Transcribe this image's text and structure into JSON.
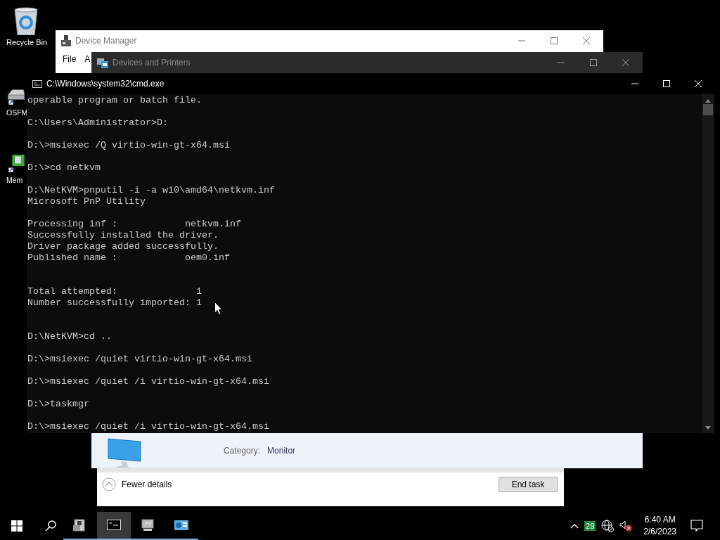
{
  "desktop_icons": [
    {
      "label": "Recycle Bin",
      "kind": "recycle"
    },
    {
      "label": "OSFM",
      "kind": "drive"
    },
    {
      "label": "Mem",
      "kind": "board"
    }
  ],
  "device_manager": {
    "title": "Device Manager",
    "menu": [
      "File",
      "A"
    ]
  },
  "devices_and_printers": {
    "title": "Devices and Printers",
    "device": {
      "category_label": "Category:",
      "category": "Monitor"
    }
  },
  "task_manager": {
    "toggle": "Fewer details",
    "button": "End task"
  },
  "console": {
    "title": "C:\\Windows\\system32\\cmd.exe",
    "lines": [
      {
        "kind": "text",
        "text": "operable program or batch file."
      },
      {
        "kind": "blank"
      },
      {
        "kind": "text",
        "text": "C:\\Users\\Administrator>D:"
      },
      {
        "kind": "blank"
      },
      {
        "kind": "text",
        "text": "D:\\>msiexec /Q virtio-win-gt-x64.msi"
      },
      {
        "kind": "blank"
      },
      {
        "kind": "text",
        "text": "D:\\>cd netkvm"
      },
      {
        "kind": "blank"
      },
      {
        "kind": "text",
        "text": "D:\\NetKVM>pnputil -i -a w10\\amd64\\netkvm.inf"
      },
      {
        "kind": "text",
        "text": "Microsoft PnP Utility"
      },
      {
        "kind": "blank"
      },
      {
        "kind": "text",
        "text": "Processing inf :            netkvm.inf"
      },
      {
        "kind": "text",
        "text": "Successfully installed the driver."
      },
      {
        "kind": "text",
        "text": "Driver package added successfully."
      },
      {
        "kind": "text",
        "text": "Published name :            oem0.inf"
      },
      {
        "kind": "blank"
      },
      {
        "kind": "blank"
      },
      {
        "kind": "text",
        "text": "Total attempted:              1"
      },
      {
        "kind": "text",
        "text": "Number successfully imported: 1"
      },
      {
        "kind": "blank"
      },
      {
        "kind": "blank"
      },
      {
        "kind": "text",
        "text": "D:\\NetKVM>cd .."
      },
      {
        "kind": "blank"
      },
      {
        "kind": "text",
        "text": "D:\\>msiexec /quiet virtio-win-gt-x64.msi"
      },
      {
        "kind": "blank"
      },
      {
        "kind": "text",
        "text": "D:\\>msiexec /quiet /i virtio-win-gt-x64.msi"
      },
      {
        "kind": "blank"
      },
      {
        "kind": "text",
        "text": "D:\\>taskmgr"
      },
      {
        "kind": "blank"
      },
      {
        "kind": "text",
        "text": "D:\\>msiexec /quiet /i virtio-win-gt-x64.msi"
      }
    ]
  },
  "taskbar": {
    "apps": [
      {
        "kind": "server",
        "selected": false
      },
      {
        "kind": "console",
        "selected": true
      },
      {
        "kind": "monitor",
        "selected": false
      },
      {
        "kind": "devices",
        "selected": false
      }
    ],
    "tray": {
      "badge": "29",
      "time": "6:40 AM",
      "date": "2/6/2023"
    }
  }
}
